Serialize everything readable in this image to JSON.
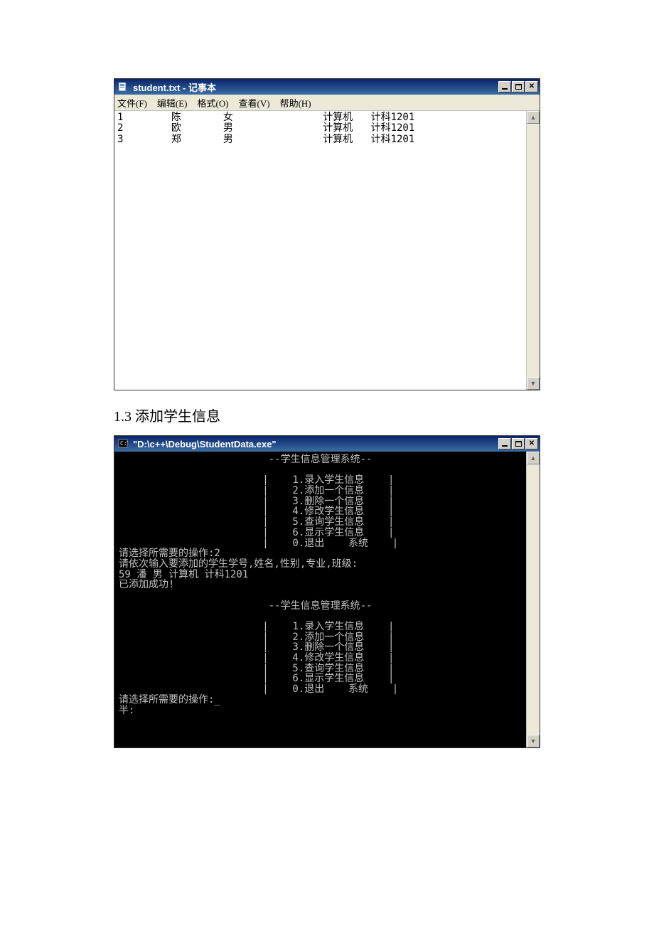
{
  "notepad": {
    "title": "student.txt - 记事本",
    "menu": {
      "file": "文件(F)",
      "edit": "编辑(E)",
      "format": "格式(O)",
      "view": "查看(V)",
      "help": "帮助(H)"
    },
    "content": "1        陈       女               计算机   计科1201\n2        欧       男               计算机   计科1201\n3        郑       男               计算机   计科1201"
  },
  "section_heading": "1.3 添加学生信息",
  "console": {
    "title": "\"D:\\c++\\Debug\\StudentData.exe\"",
    "content": "                         --学生信息管理系统--\n\n                        |    1.录入学生信息    |\n                        |    2.添加一个信息    |\n                        |    3.删除一个信息    |\n                        |    4.修改学生信息    |\n                        |    5.查询学生信息    |\n                        |    6.显示学生信息    |\n                        |    0.退出    系统    |\n请选择所需要的操作:2\n请依次输入要添加的学生学号,姓名,性别,专业,班级:\n59 潘 男 计算机 计科1201\n已添加成功!\n\n                         --学生信息管理系统--\n\n                        |    1.录入学生信息    |\n                        |    2.添加一个信息    |\n                        |    3.删除一个信息    |\n                        |    4.修改学生信息    |\n                        |    5.查询学生信息    |\n                        |    6.显示学生信息    |\n                        |    0.退出    系统    |\n请选择所需要的操作:_\n半:"
  },
  "scroll": {
    "up": "▲",
    "down": "▼"
  }
}
